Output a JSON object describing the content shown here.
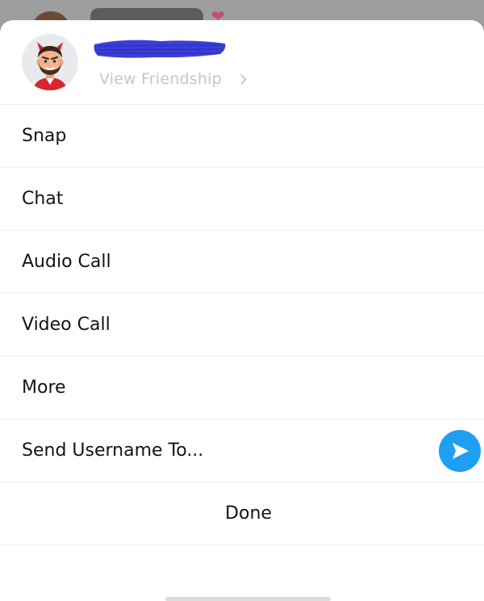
{
  "background": {
    "heart": "❤"
  },
  "profile": {
    "view_friendship_label": "View Friendship",
    "name_redaction_color": "#3b3fd6"
  },
  "menu": {
    "items": [
      {
        "label": "Snap"
      },
      {
        "label": "Chat"
      },
      {
        "label": "Audio Call"
      },
      {
        "label": "Video Call"
      },
      {
        "label": "More"
      },
      {
        "label": "Send Username To..."
      }
    ],
    "done_label": "Done"
  },
  "colors": {
    "send_button": "#1e9ff2",
    "text": "#141414",
    "muted_text": "#c4c6ca"
  }
}
